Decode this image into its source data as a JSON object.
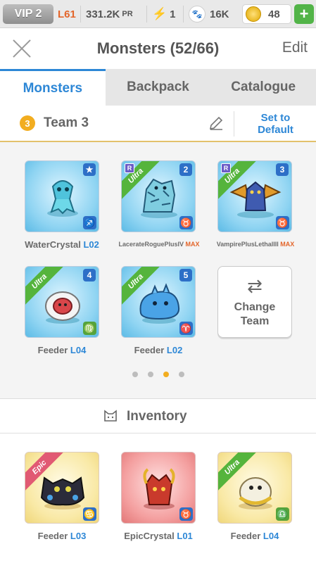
{
  "status": {
    "vip": "VIP 2",
    "level": "L61",
    "power": "331.2K",
    "power_suffix": "PR",
    "energy": "1",
    "food": "16K",
    "coins": "48",
    "add": "+"
  },
  "header": {
    "title": "Monsters (52/66)",
    "edit": "Edit"
  },
  "tabs": [
    {
      "label": "Monsters",
      "active": true
    },
    {
      "label": "Backpack",
      "active": false
    },
    {
      "label": "Catalogue",
      "active": false
    }
  ],
  "team": {
    "number": "3",
    "name": "Team 3",
    "set_default_line1": "Set to",
    "set_default_line2": "Default"
  },
  "team_monsters": [
    {
      "name": "WaterCrystal",
      "level": "L02",
      "slot": "★",
      "rarity": "",
      "rank": "",
      "zodiac": "♐"
    },
    {
      "name": "LacerateRoguePlusIV",
      "level": "",
      "max": "MAX",
      "slot": "2",
      "rarity": "Ultra",
      "rank": "R",
      "zodiac": "♉"
    },
    {
      "name": "VampirePlusLethalIII",
      "level": "",
      "max": "MAX",
      "slot": "3",
      "rarity": "Ultra",
      "rank": "R",
      "zodiac": "♉"
    },
    {
      "name": "Feeder",
      "level": "L04",
      "slot": "4",
      "rarity": "Ultra",
      "rank": "",
      "zodiac": "♍"
    },
    {
      "name": "Feeder",
      "level": "L02",
      "slot": "5",
      "rarity": "Ultra",
      "rank": "",
      "zodiac": "♈"
    }
  ],
  "change_team": {
    "line1": "Change",
    "line2": "Team",
    "arrows": "⇄"
  },
  "inventory": {
    "label": "Inventory",
    "items": [
      {
        "name": "Feeder",
        "level": "L03",
        "rarity": "Epic",
        "zodiac": "♋"
      },
      {
        "name": "EpicCrystal",
        "level": "L01",
        "rarity": "",
        "zodiac": "♉"
      },
      {
        "name": "Feeder",
        "level": "L04",
        "rarity": "Ultra",
        "zodiac": "♎"
      }
    ]
  },
  "pager": {
    "pages": 4,
    "current": 3
  }
}
